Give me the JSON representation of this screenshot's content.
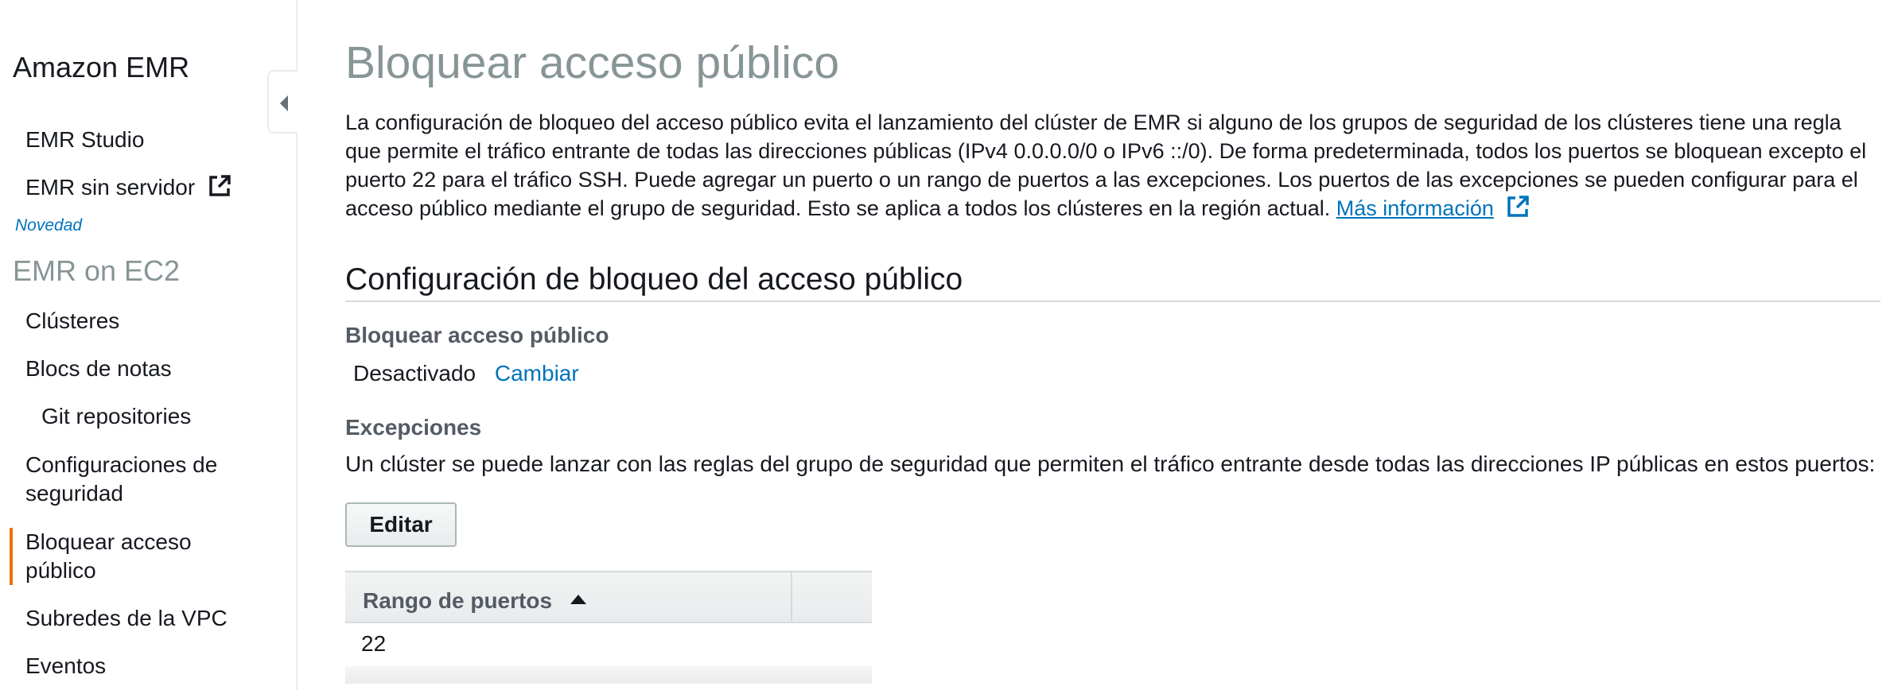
{
  "sidebar": {
    "title": "Amazon EMR",
    "items": [
      {
        "label": "EMR Studio"
      },
      {
        "label": "EMR sin servidor",
        "icon": "external-link-icon"
      },
      {
        "label": "Novedad"
      },
      {
        "label": "EMR on EC2"
      },
      {
        "label": "Clústeres"
      },
      {
        "label": "Blocs de notas"
      },
      {
        "label": "Git repositories"
      },
      {
        "label": "Configuraciones de seguridad"
      },
      {
        "label": "Bloquear acceso público"
      },
      {
        "label": "Subredes de la VPC"
      },
      {
        "label": "Eventos"
      }
    ],
    "collapse_icon": "caret-left-icon"
  },
  "main": {
    "title": "Bloquear acceso público",
    "intro": "La configuración de bloqueo del acceso público evita el lanzamiento del clúster de EMR si alguno de los grupos de seguridad de los clústeres tiene una regla que permite el tráfico entrante de todas las direcciones públicas (IPv4 0.0.0.0/0 o IPv6 ::/0). De forma predeterminada, todos los puertos se bloquean excepto el puerto 22 para el tráfico SSH. Puede agregar un puerto o un rango de puertos a las excepciones. Los puertos de las excepciones se pueden configurar para el acceso público mediante el grupo de seguridad. Esto se aplica a todos los clústeres en la región actual.",
    "learn_more": "Más información",
    "config_section_title": "Configuración de bloqueo del acceso público",
    "block_label": "Bloquear acceso público",
    "block_status": "Desactivado",
    "change_label": "Cambiar",
    "exceptions_label": "Excepciones",
    "exceptions_desc": "Un clúster se puede lanzar con las reglas del grupo de seguridad que permiten el tráfico entrante desde todas las direcciones IP públicas en estos puertos:",
    "edit_label": "Editar",
    "table": {
      "columns": [
        "Rango de puertos"
      ],
      "sort": "ascending",
      "rows": [
        [
          "22"
        ]
      ]
    }
  },
  "colors": {
    "accent": "#ec7211",
    "link": "#0073bb",
    "muted": "#879596"
  }
}
